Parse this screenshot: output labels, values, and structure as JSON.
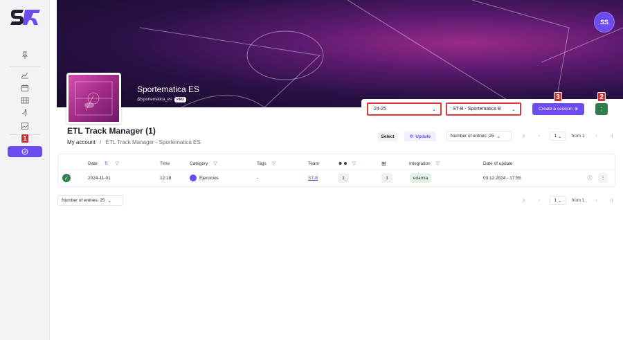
{
  "app": {
    "logo_text": "ST",
    "avatar_initials": "SS"
  },
  "sidebar": {
    "items": [
      {
        "name": "pin-icon"
      },
      {
        "name": "chart-icon"
      },
      {
        "name": "calendar-icon"
      },
      {
        "name": "film-icon"
      },
      {
        "name": "runner-icon"
      },
      {
        "name": "image-icon"
      },
      {
        "name": "track-icon",
        "active": true
      }
    ]
  },
  "profile": {
    "name": "Sportematica ES",
    "handle": "@sportematica_es",
    "badge": "PRO"
  },
  "controls": {
    "season": "24-25",
    "team": "ST-B - Sportematica B",
    "create_session": "Create a session",
    "more": "⋮"
  },
  "markers": [
    "1",
    "2",
    "3"
  ],
  "page": {
    "title": "ETL Track Manager (1)",
    "breadcrumb_home": "My account",
    "breadcrumb_sep": "/",
    "breadcrumb_current": "ETL Track Manager - Sportematica ES"
  },
  "toolbar": {
    "select": "Select",
    "update": "Update",
    "entries_label": "Number of entries: 25",
    "page": "1",
    "from": "from 1"
  },
  "table": {
    "headers": {
      "date": "Date",
      "time": "Time",
      "category": "Category",
      "tags": "Tags",
      "team": "Team",
      "integration": "Integration",
      "date_update": "Date of update"
    },
    "rows": [
      {
        "date": "2024-11-01",
        "time": "12:18",
        "category": "Ejercicios",
        "tags": "-",
        "team": "ST-B",
        "players": "1",
        "crop": "1",
        "integration": "edamia",
        "updated": "03.12.2024 - 17:55"
      }
    ]
  },
  "footer": {
    "entries_label": "Number of entries: 25",
    "page": "1",
    "from": "from 1"
  },
  "colors": {
    "accent": "#6c4cf1",
    "success": "#2f7d4a",
    "marker": "#c8322f"
  }
}
